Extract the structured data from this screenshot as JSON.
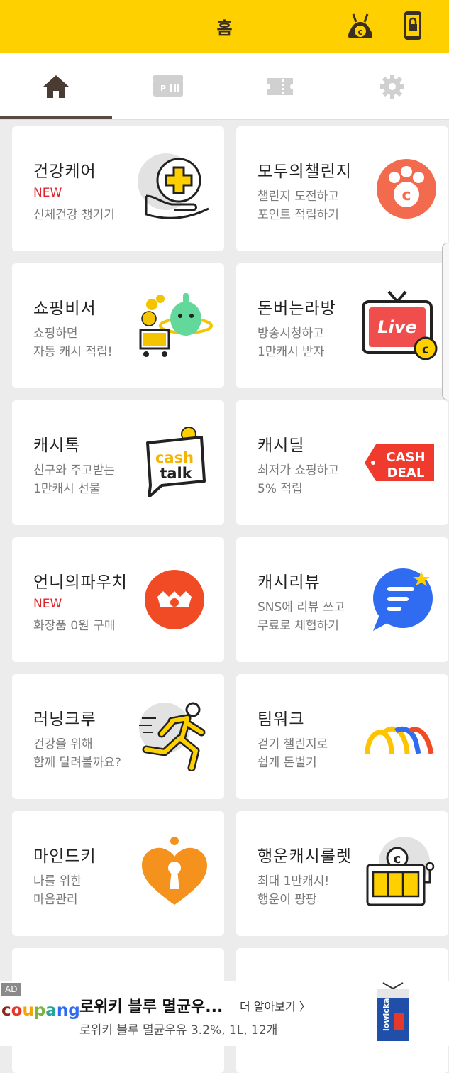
{
  "header": {
    "title": "홈",
    "left_icon": "cash-bag-icon",
    "right_icon": "phone-lock-icon"
  },
  "tabs": [
    {
      "icon": "home-icon",
      "active": true
    },
    {
      "icon": "coupon-shop-icon",
      "active": false
    },
    {
      "icon": "ticket-icon",
      "active": false
    },
    {
      "icon": "gear-icon",
      "active": false
    }
  ],
  "cards": [
    {
      "name": "건강케어",
      "new": "NEW",
      "desc1": "신체건강 챙기기",
      "desc2": "",
      "icon": "health-plus-hand-icon"
    },
    {
      "name": "모두의챌린지",
      "new": "",
      "desc1": "챌린지 도전하고",
      "desc2": "포인트 적립하기",
      "icon": "paw-coin-icon"
    },
    {
      "name": "쇼핑비서",
      "new": "",
      "desc1": "쇼핑하면",
      "desc2": "자동 캐시 적립!",
      "icon": "shopping-cart-character-icon"
    },
    {
      "name": "돈버는라방",
      "new": "",
      "desc1": "방송시청하고",
      "desc2": "1만캐시 받자",
      "icon": "live-tv-icon"
    },
    {
      "name": "캐시톡",
      "new": "",
      "desc1": "친구와 주고받는",
      "desc2": "1만캐시 선물",
      "icon": "cash-talk-icon"
    },
    {
      "name": "캐시딜",
      "new": "",
      "desc1": "최저가 쇼핑하고",
      "desc2": "5% 적립",
      "icon": "cash-deal-tag-icon"
    },
    {
      "name": "언니의파우치",
      "new": "NEW",
      "desc1": "화장품 0원 구매",
      "desc2": "",
      "icon": "pouch-logo-icon"
    },
    {
      "name": "캐시리뷰",
      "new": "",
      "desc1": "SNS에 리뷰 쓰고",
      "desc2": "무료로 체험하기",
      "icon": "review-bubble-icon"
    },
    {
      "name": "러닝크루",
      "new": "",
      "desc1": "건강을 위해",
      "desc2": "함께 달려볼까요?",
      "icon": "runner-icon"
    },
    {
      "name": "팀워크",
      "new": "",
      "desc1": "걷기 챌린지로",
      "desc2": "쉽게 돈벌기",
      "icon": "teamwork-arches-icon"
    },
    {
      "name": "마인드키",
      "new": "",
      "desc1": "나를 위한",
      "desc2": "마음관리",
      "icon": "heart-keyhole-icon"
    },
    {
      "name": "행운캐시룰렛",
      "new": "",
      "desc1": "최대 1만캐시!",
      "desc2": "행운이 팡팡",
      "icon": "slot-machine-icon"
    }
  ],
  "ad": {
    "tag": "AD",
    "brand": "coupang",
    "headline": "로위키 블루 멸균우...",
    "more": "더 알아보기 〉",
    "subline": "로위키 블루 멸균우유 3.2%, 1L, 12개",
    "product_icon": "milk-carton-icon"
  },
  "colors": {
    "header": "#ffd000",
    "accent_red": "#e0252a",
    "orange": "#f05a28"
  }
}
